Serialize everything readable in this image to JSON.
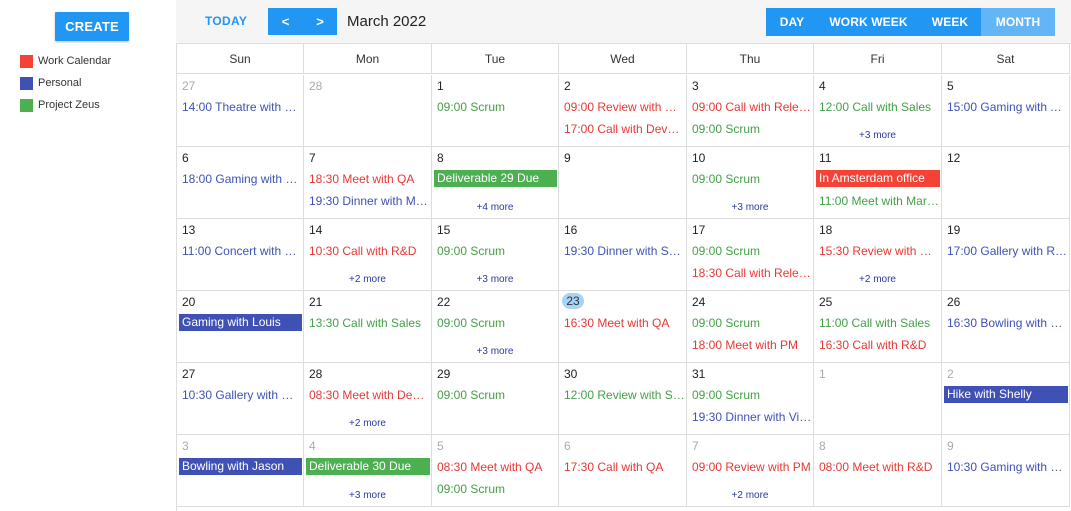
{
  "sidebar": {
    "create_label": "CREATE",
    "calendars": [
      {
        "label": "Work Calendar",
        "color": "#f44336"
      },
      {
        "label": "Personal",
        "color": "#3f51b5"
      },
      {
        "label": "Project Zeus",
        "color": "#4caf50"
      }
    ]
  },
  "toolbar": {
    "today_label": "TODAY",
    "prev_label": "<",
    "next_label": ">",
    "title": "March 2022",
    "views": [
      {
        "label": "DAY",
        "active": false
      },
      {
        "label": "WORK WEEK",
        "active": false
      },
      {
        "label": "WEEK",
        "active": false
      },
      {
        "label": "MONTH",
        "active": true
      }
    ]
  },
  "days_of_week": [
    "Sun",
    "Mon",
    "Tue",
    "Wed",
    "Thu",
    "Fri",
    "Sat"
  ],
  "weeks": [
    [
      {
        "day": "27",
        "other": true,
        "events": [
          {
            "text": "14:00 Theatre with M…",
            "cal": "personal"
          }
        ]
      },
      {
        "day": "28",
        "other": true,
        "events": []
      },
      {
        "day": "1",
        "events": [
          {
            "text": "09:00 Scrum",
            "cal": "zeus"
          }
        ]
      },
      {
        "day": "2",
        "events": [
          {
            "text": "09:00 Review with Re…",
            "cal": "work"
          },
          {
            "text": "17:00 Call with Devel…",
            "cal": "work"
          }
        ]
      },
      {
        "day": "3",
        "events": [
          {
            "text": "09:00 Call with Relea…",
            "cal": "work"
          },
          {
            "text": "09:00 Scrum",
            "cal": "zeus"
          }
        ]
      },
      {
        "day": "4",
        "events": [
          {
            "text": "12:00 Call with Sales",
            "cal": "zeus"
          }
        ],
        "more": "+3 more"
      },
      {
        "day": "5",
        "events": [
          {
            "text": "15:00 Gaming with A…",
            "cal": "personal"
          }
        ]
      }
    ],
    [
      {
        "day": "6",
        "events": [
          {
            "text": "18:00 Gaming with El…",
            "cal": "personal"
          }
        ]
      },
      {
        "day": "7",
        "events": [
          {
            "text": "18:30 Meet with QA",
            "cal": "work"
          },
          {
            "text": "19:30 Dinner with Mit…",
            "cal": "personal"
          }
        ]
      },
      {
        "day": "8",
        "events": [
          {
            "text": "Deliverable 29 Due",
            "cal": "zeus",
            "bar": true
          }
        ],
        "more": "+4 more"
      },
      {
        "day": "9",
        "events": []
      },
      {
        "day": "10",
        "events": [
          {
            "text": "09:00 Scrum",
            "cal": "zeus"
          }
        ],
        "more": "+3 more"
      },
      {
        "day": "11",
        "events": [
          {
            "text": "In Amsterdam office",
            "cal": "work",
            "bar": true
          },
          {
            "text": "11:00 Meet with Mar…",
            "cal": "zeus"
          }
        ]
      },
      {
        "day": "12",
        "events": []
      }
    ],
    [
      {
        "day": "13",
        "events": [
          {
            "text": "11:00 Concert with Vi…",
            "cal": "personal"
          }
        ]
      },
      {
        "day": "14",
        "events": [
          {
            "text": "10:30 Call with R&D",
            "cal": "work"
          }
        ],
        "more": "+2 more"
      },
      {
        "day": "15",
        "events": [
          {
            "text": "09:00 Scrum",
            "cal": "zeus"
          }
        ],
        "more": "+3 more"
      },
      {
        "day": "16",
        "events": [
          {
            "text": "19:30 Dinner with Sh…",
            "cal": "personal"
          }
        ]
      },
      {
        "day": "17",
        "events": [
          {
            "text": "09:00 Scrum",
            "cal": "zeus"
          },
          {
            "text": "18:30 Call with Relea…",
            "cal": "work"
          }
        ]
      },
      {
        "day": "18",
        "events": [
          {
            "text": "15:30 Review with R&D",
            "cal": "work"
          }
        ],
        "more": "+2 more"
      },
      {
        "day": "19",
        "events": [
          {
            "text": "17:00 Gallery with Ra…",
            "cal": "personal"
          }
        ]
      }
    ],
    [
      {
        "day": "20",
        "events": [
          {
            "text": "Gaming with Louis",
            "cal": "personal",
            "bar": true
          }
        ]
      },
      {
        "day": "21",
        "events": [
          {
            "text": "13:30 Call with Sales",
            "cal": "zeus"
          }
        ]
      },
      {
        "day": "22",
        "events": [
          {
            "text": "09:00 Scrum",
            "cal": "zeus"
          }
        ],
        "more": "+3 more"
      },
      {
        "day": "23",
        "today": true,
        "events": [
          {
            "text": "16:30 Meet with QA",
            "cal": "work"
          }
        ]
      },
      {
        "day": "24",
        "events": [
          {
            "text": "09:00 Scrum",
            "cal": "zeus"
          },
          {
            "text": "18:00 Meet with PM",
            "cal": "work"
          }
        ]
      },
      {
        "day": "25",
        "events": [
          {
            "text": "11:00 Call with Sales",
            "cal": "zeus"
          },
          {
            "text": "16:30 Call with R&D",
            "cal": "work"
          }
        ]
      },
      {
        "day": "26",
        "events": [
          {
            "text": "16:30 Bowling with J…",
            "cal": "personal"
          }
        ]
      }
    ],
    [
      {
        "day": "27",
        "events": [
          {
            "text": "10:30 Gallery with Ra…",
            "cal": "personal"
          }
        ]
      },
      {
        "day": "28",
        "events": [
          {
            "text": "08:30 Meet with Dev…",
            "cal": "work"
          }
        ],
        "more": "+2 more"
      },
      {
        "day": "29",
        "events": [
          {
            "text": "09:00 Scrum",
            "cal": "zeus"
          }
        ]
      },
      {
        "day": "30",
        "events": [
          {
            "text": "12:00 Review with Sa…",
            "cal": "zeus"
          }
        ]
      },
      {
        "day": "31",
        "events": [
          {
            "text": "09:00 Scrum",
            "cal": "zeus"
          },
          {
            "text": "19:30 Dinner with Vicki",
            "cal": "personal"
          }
        ]
      },
      {
        "day": "1",
        "other": true,
        "events": []
      },
      {
        "day": "2",
        "other": true,
        "events": [
          {
            "text": "Hike with Shelly",
            "cal": "personal",
            "bar": true
          }
        ]
      }
    ],
    [
      {
        "day": "3",
        "other": true,
        "events": [
          {
            "text": "Bowling with Jason",
            "cal": "personal",
            "bar": true
          }
        ]
      },
      {
        "day": "4",
        "other": true,
        "events": [
          {
            "text": "Deliverable 30 Due",
            "cal": "zeus",
            "bar": true
          }
        ],
        "more": "+3 more"
      },
      {
        "day": "5",
        "other": true,
        "events": [
          {
            "text": "08:30 Meet with QA",
            "cal": "work"
          },
          {
            "text": "09:00 Scrum",
            "cal": "zeus"
          }
        ]
      },
      {
        "day": "6",
        "other": true,
        "events": [
          {
            "text": "17:30 Call with QA",
            "cal": "work"
          }
        ]
      },
      {
        "day": "7",
        "other": true,
        "events": [
          {
            "text": "09:00 Review with PM",
            "cal": "work"
          }
        ],
        "more": "+2 more"
      },
      {
        "day": "8",
        "other": true,
        "events": [
          {
            "text": "08:00 Meet with R&D",
            "cal": "work"
          }
        ]
      },
      {
        "day": "9",
        "other": true,
        "events": [
          {
            "text": "10:30 Gaming with Fr…",
            "cal": "personal"
          }
        ]
      }
    ]
  ]
}
